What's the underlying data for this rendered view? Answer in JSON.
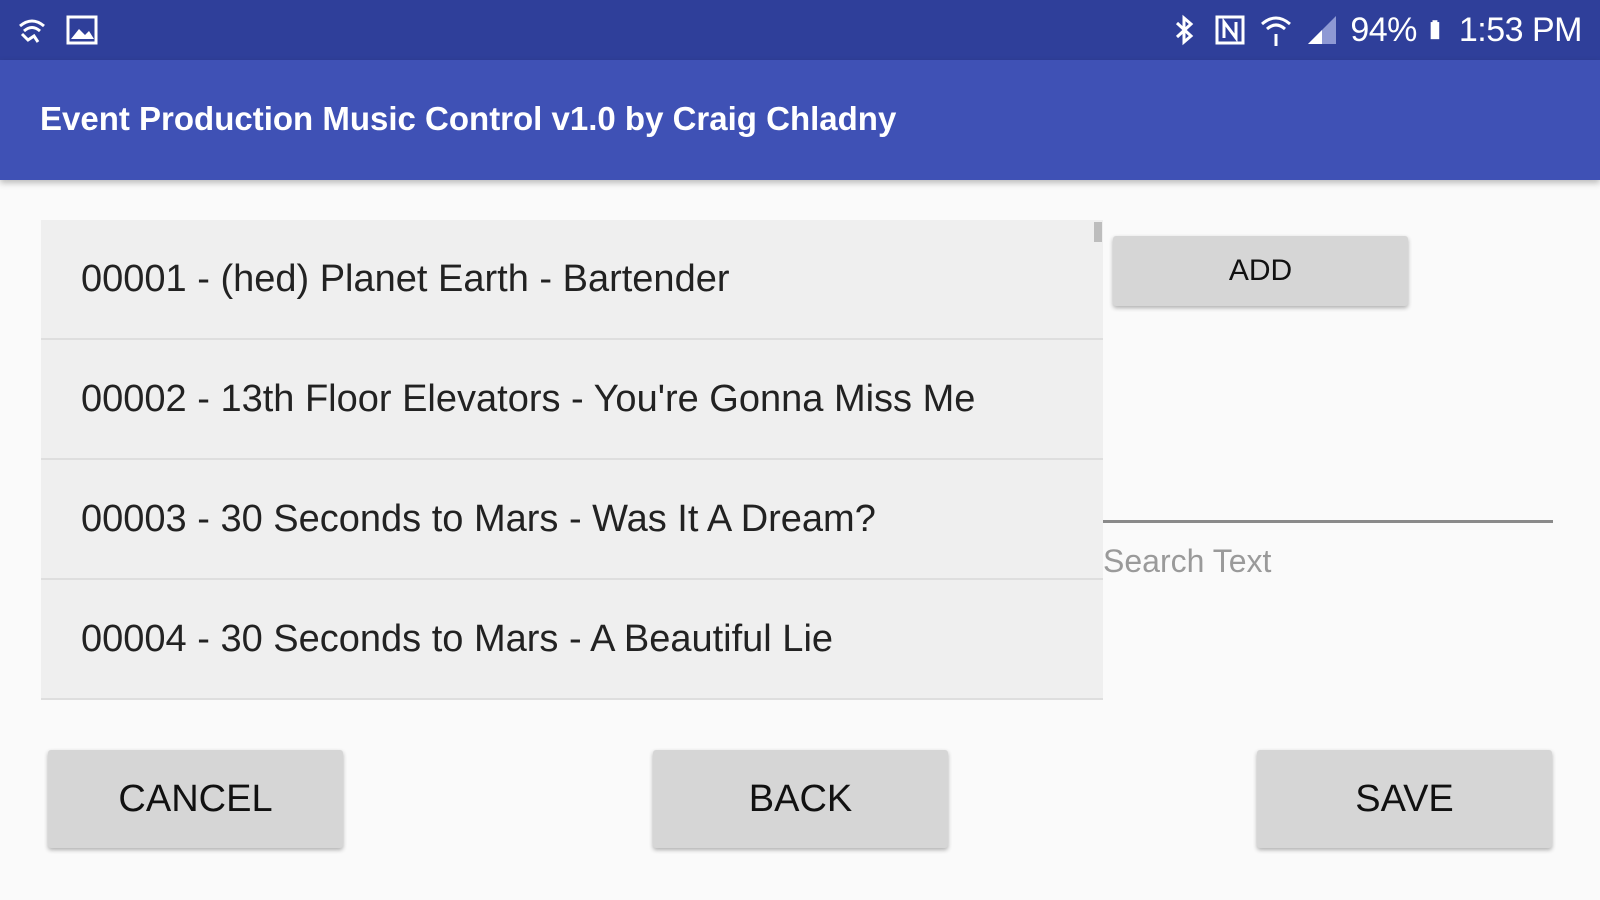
{
  "status_bar": {
    "battery": "94%",
    "time": "1:53 PM",
    "icons_left": [
      "wifi-call-icon",
      "image-icon"
    ],
    "icons_right": [
      "bluetooth-icon",
      "nfc-icon",
      "wifi-icon",
      "signal-icon",
      "battery-icon"
    ]
  },
  "app_bar": {
    "title": "Event Production Music Control v1.0 by Craig Chladny"
  },
  "songs": [
    "00001 - (hed) Planet Earth - Bartender",
    "00002 - 13th Floor Elevators - You're Gonna Miss Me",
    "00003 - 30 Seconds to Mars - Was It A Dream?",
    "00004 - 30 Seconds to Mars - A Beautiful Lie"
  ],
  "controls": {
    "add_label": "ADD",
    "search_placeholder": "Search Text",
    "search_value": ""
  },
  "bottom_buttons": {
    "cancel_label": "CANCEL",
    "back_label": "BACK",
    "save_label": "SAVE"
  },
  "colors": {
    "status_bar": "#2f3f9a",
    "app_bar": "#3f51b5",
    "button": "#d6d6d6",
    "list_item": "#efefef"
  }
}
